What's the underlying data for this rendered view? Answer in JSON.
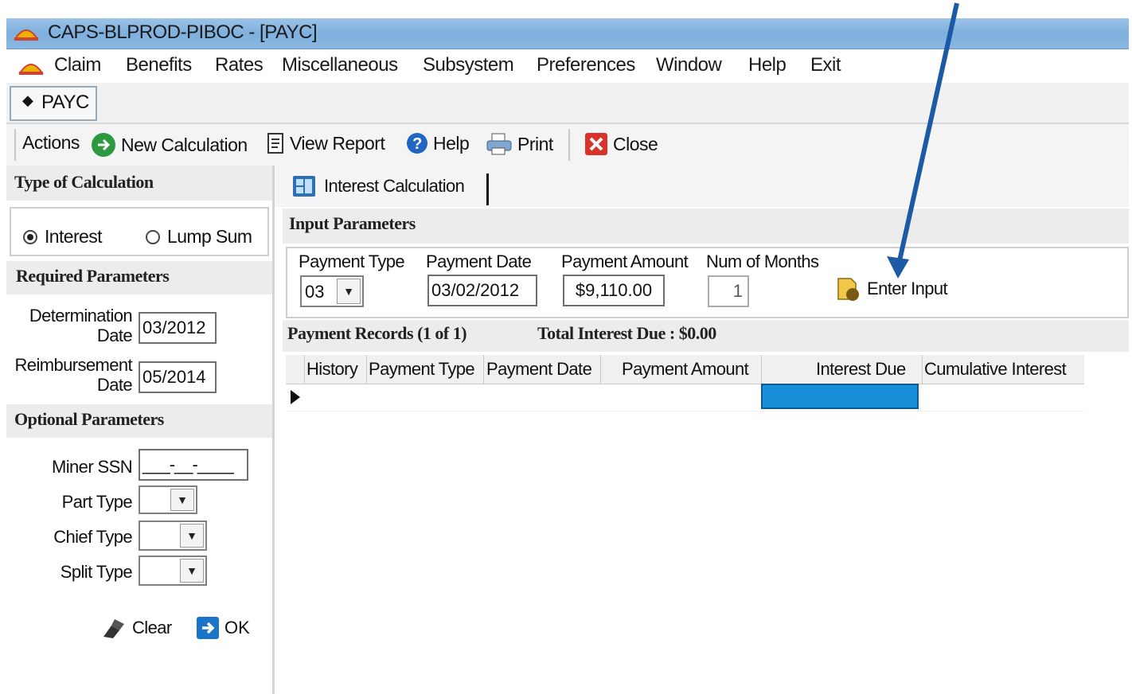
{
  "window": {
    "title": "CAPS-BLPROD-PIBOC - [PAYC]"
  },
  "menu": [
    "Claim",
    "Benefits",
    "Rates",
    "Miscellaneous",
    "Subsystem",
    "Preferences",
    "Window",
    "Help",
    "Exit"
  ],
  "doc_tab": "PAYC",
  "toolbar": {
    "actions": "Actions",
    "new_calc": "New Calculation",
    "view_report": "View Report",
    "help": "Help",
    "print": "Print",
    "close": "Close"
  },
  "left": {
    "type_header": "Type of Calculation",
    "radio_interest": "Interest",
    "radio_lump": "Lump Sum",
    "selected": "Interest",
    "required_header": "Required Parameters",
    "determination_label_1": "Determination",
    "determination_label_2": "Date",
    "determination_value": "03/2012",
    "reimbursement_label_1": "Reimbursement",
    "reimbursement_label_2": "Date",
    "reimbursement_value": "05/2014",
    "optional_header": "Optional Parameters",
    "miner_ssn_label": "Miner SSN",
    "miner_ssn_value": "___-__-____",
    "part_type_label": "Part Type",
    "chief_type_label": "Chief Type",
    "split_type_label": "Split Type",
    "clear": "Clear",
    "ok": "OK"
  },
  "main": {
    "tab": "Interest Calculation",
    "input_header": "Input Parameters",
    "payment_type_label": "Payment Type",
    "payment_type_value": "03",
    "payment_date_label": "Payment Date",
    "payment_date_value": "03/02/2012",
    "payment_amount_label": "Payment Amount",
    "payment_amount_value": "$9,110.00",
    "num_months_label": "Num of Months",
    "num_months_value": "1",
    "enter_input": "Enter Input",
    "records_header": "Payment Records (1 of 1)",
    "total_interest": "Total Interest Due : $0.00",
    "columns": [
      "History",
      "Payment Type",
      "Payment Date",
      "Payment Amount",
      "Interest Due",
      "Cumulative Interest"
    ]
  },
  "colors": {
    "titlebar": "#8ab8e2",
    "selection": "#1a8fd9",
    "annotation_arrow": "#1c5aa6"
  }
}
